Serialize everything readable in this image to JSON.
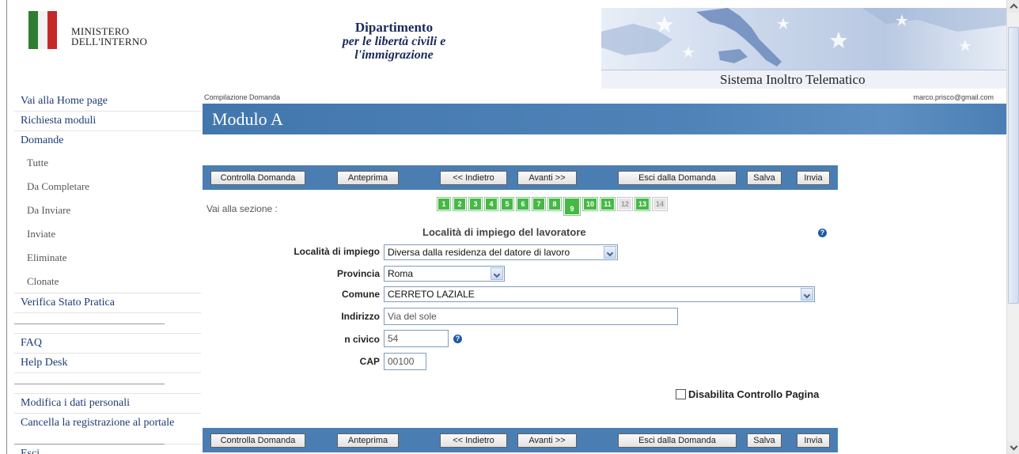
{
  "header": {
    "ministero_line1": "MINISTERO",
    "ministero_line2": "DELL'INTERNO",
    "dept_line1": "Dipartimento",
    "dept_line2": "per le libertà civili e",
    "dept_line3": "l'immigrazione",
    "system_title": "Sistema Inoltro Telematico"
  },
  "sidebar": {
    "items": [
      {
        "label": "Vai alla Home page"
      },
      {
        "label": "Richiesta moduli"
      },
      {
        "label": "Domande"
      },
      {
        "label": "Tutte"
      },
      {
        "label": "Da Completare"
      },
      {
        "label": "Da Inviare"
      },
      {
        "label": "Inviate"
      },
      {
        "label": "Eliminate"
      },
      {
        "label": "Clonate"
      },
      {
        "label": "Verifica Stato Pratica"
      },
      {
        "label": "FAQ"
      },
      {
        "label": "Help Desk"
      },
      {
        "label": "Modifica i dati personali"
      },
      {
        "label": "Cancella la registrazione al portale"
      },
      {
        "label": "Esci"
      }
    ]
  },
  "main": {
    "breadcrumb": "Compilazione Domanda",
    "user_email": "marco.prisco@gmail.com",
    "title": "Modulo A",
    "toolbar": {
      "controlla": "Controlla Domanda",
      "anteprima": "Anteprima",
      "indietro": "<< Indietro",
      "avanti": "Avanti >>",
      "esci": "Esci dalla Domanda",
      "salva": "Salva",
      "invia": "Invia"
    },
    "vai_sezione": "Vai alla sezione :",
    "steps": [
      "1",
      "2",
      "3",
      "4",
      "5",
      "6",
      "7",
      "8",
      "9",
      "10",
      "11",
      "12",
      "13",
      "14"
    ],
    "current_step": "9",
    "section_title": "Località di impiego del lavoratore",
    "help_glyph": "?",
    "form": {
      "localita_label": "Località di impiego",
      "localita_value": "Diversa dalla residenza del datore di lavoro",
      "provincia_label": "Provincia",
      "provincia_value": "Roma",
      "comune_label": "Comune",
      "comune_value": "CERRETO LAZIALE",
      "indirizzo_label": "Indirizzo",
      "indirizzo_value": "Via del sole",
      "civico_label": "n civico",
      "civico_value": "54",
      "cap_label": "CAP",
      "cap_value": "00100"
    },
    "disabilita_label": "Disabilita Controllo Pagina"
  },
  "colors": {
    "toolbar_blue": "#4a7eb3",
    "step_green": "#46b846",
    "step_disabled": "#e4e4e4",
    "link_blue": "#1d3c73"
  }
}
